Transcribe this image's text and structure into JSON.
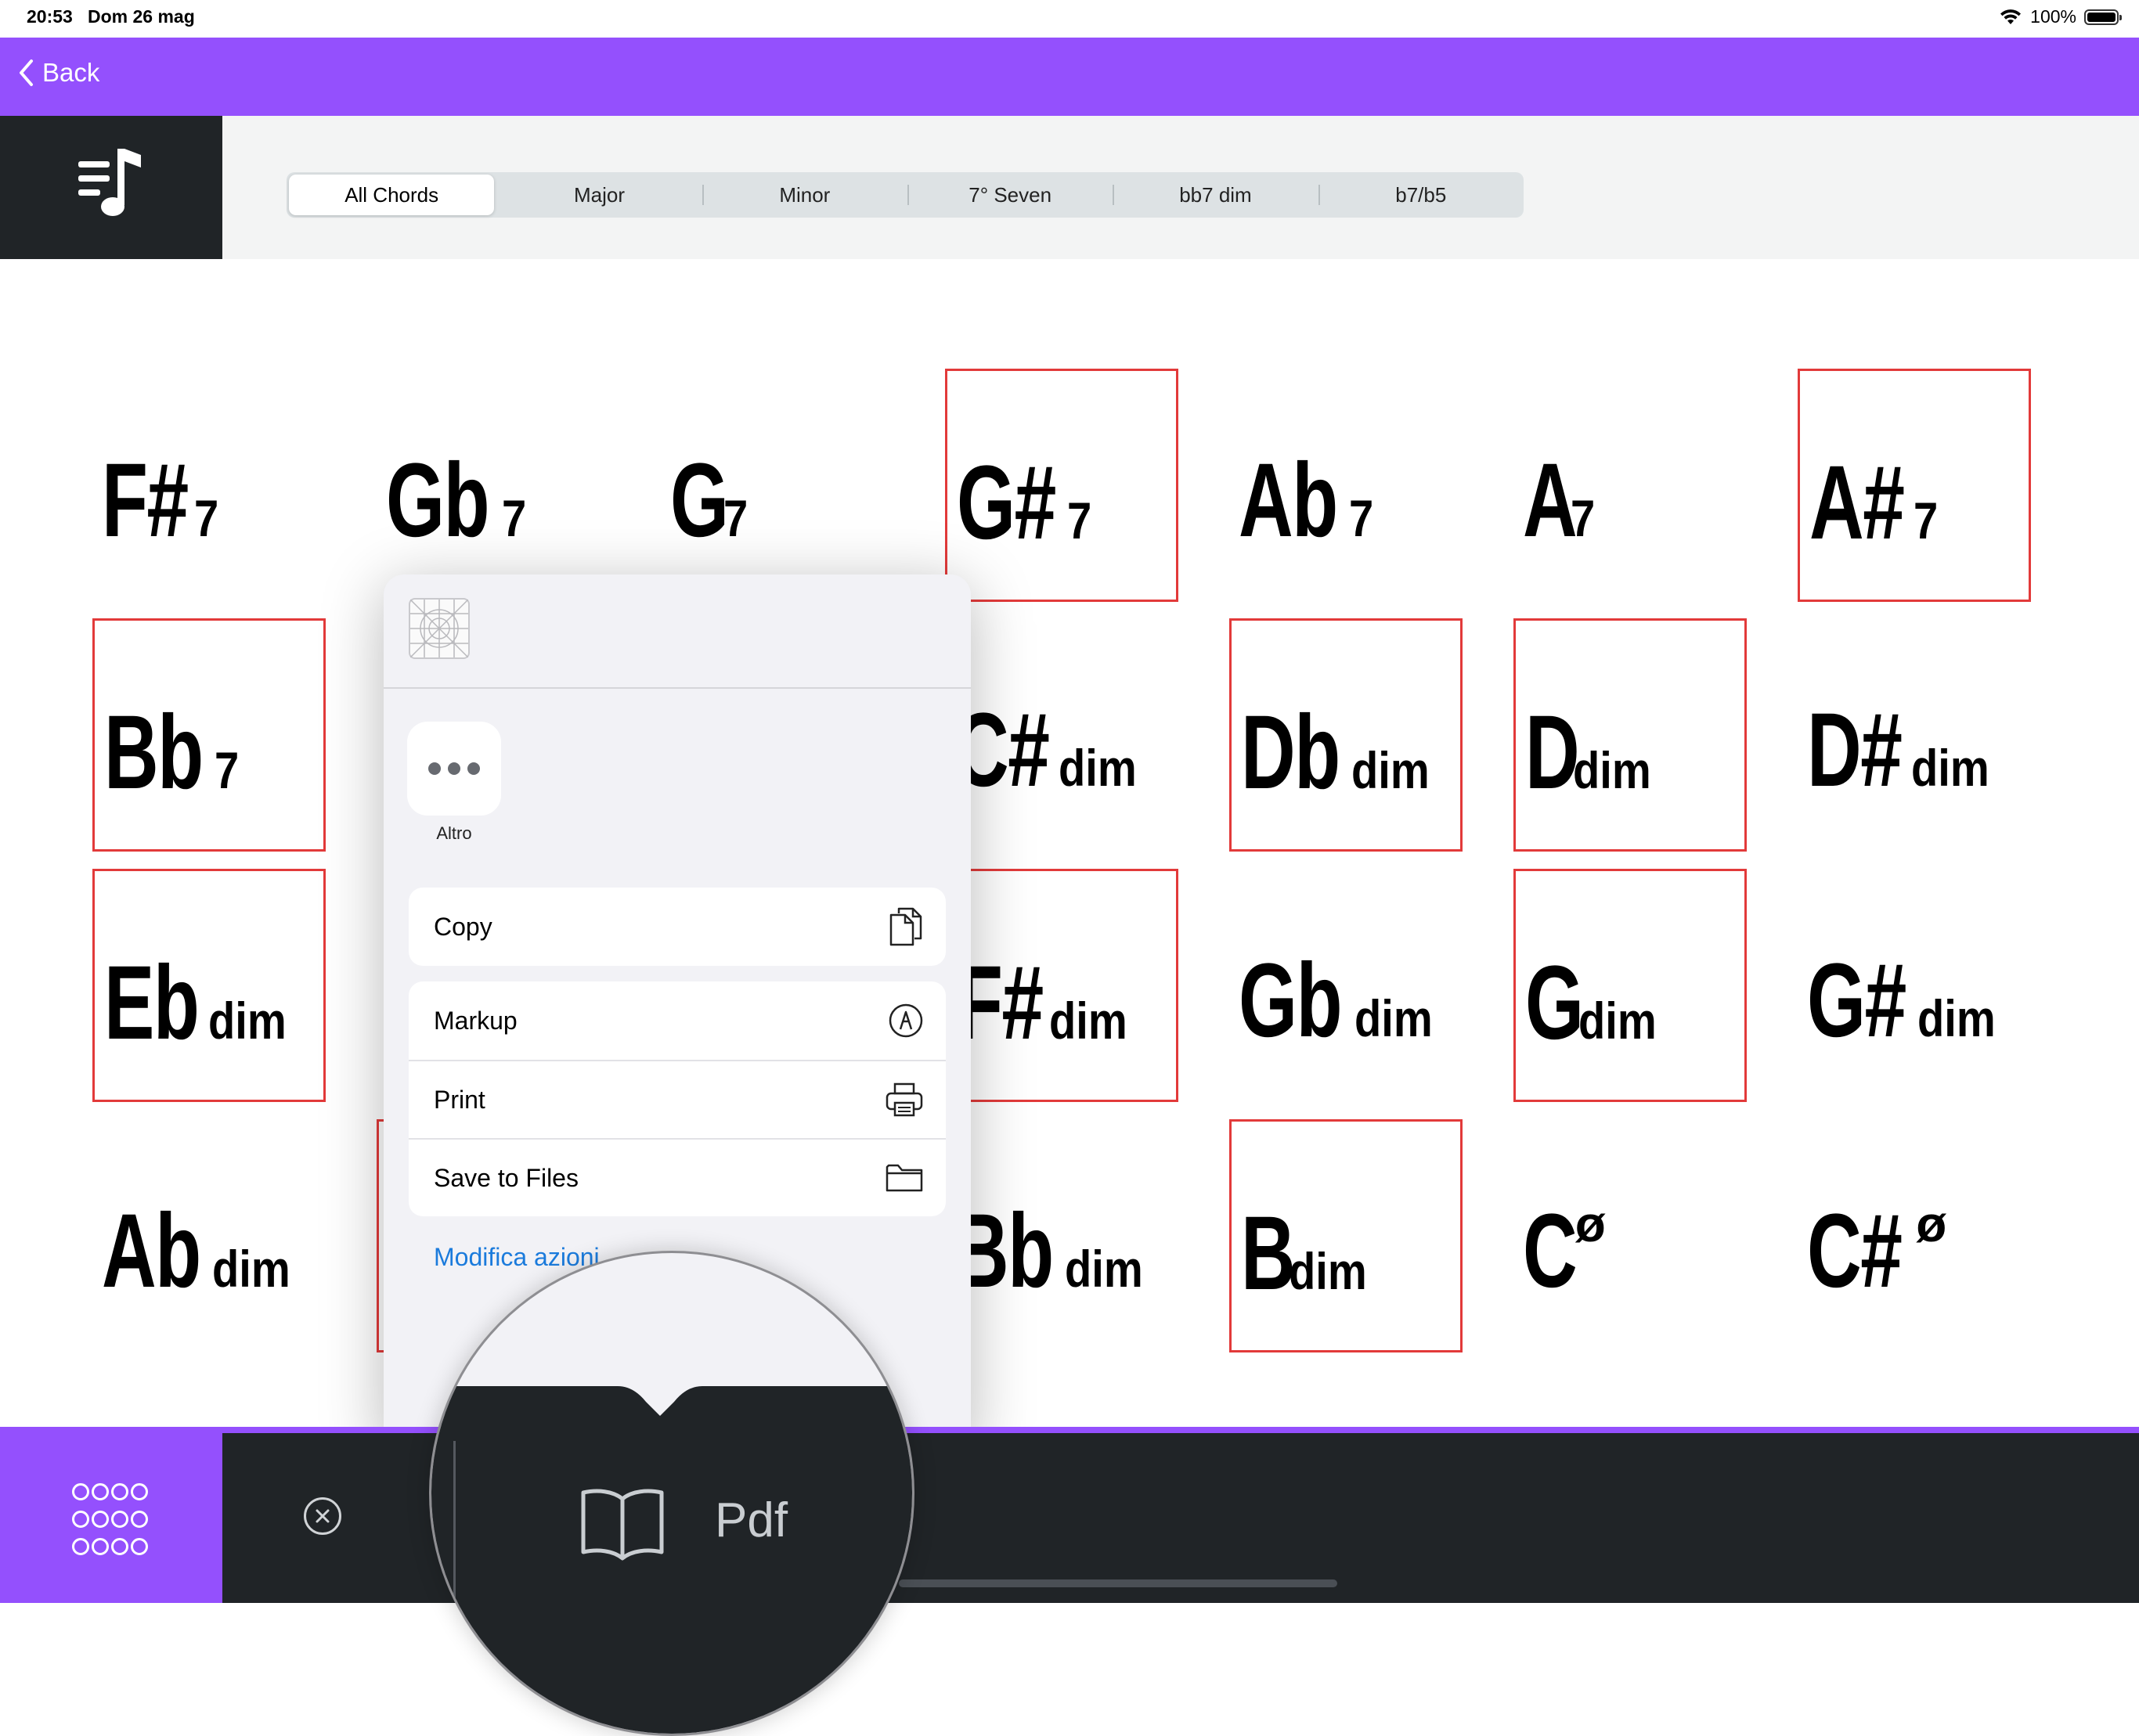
{
  "status_bar": {
    "time": "20:53",
    "date": "Dom 26 mag",
    "battery": "100%",
    "wifi_icon": "wifi-icon"
  },
  "navbar": {
    "back_label": "Back",
    "color": "#9450fd"
  },
  "tabs": [
    {
      "label": "All Chords",
      "active": true
    },
    {
      "label": "Major",
      "active": false
    },
    {
      "label": "Minor",
      "active": false
    },
    {
      "label": "7° Seven",
      "active": false
    },
    {
      "label": "bb7 dim",
      "active": false
    },
    {
      "label": "b7/b5",
      "active": false
    }
  ],
  "chords": [
    {
      "root": "F#",
      "suffix": "7",
      "highlight": false
    },
    {
      "root": "Gb",
      "suffix": "7",
      "highlight": false
    },
    {
      "root": "G",
      "suffix": "7",
      "highlight": false
    },
    {
      "root": "G#",
      "suffix": "7",
      "highlight": true
    },
    {
      "root": "Ab",
      "suffix": "7",
      "highlight": false
    },
    {
      "root": "A",
      "suffix": "7",
      "highlight": false
    },
    {
      "root": "A#",
      "suffix": "7",
      "highlight": true
    },
    {
      "root": "Bb",
      "suffix": "7",
      "highlight": true
    },
    {
      "root": "",
      "suffix": "",
      "highlight": false
    },
    {
      "root": "",
      "suffix": "",
      "highlight": false
    },
    {
      "root": "C#",
      "suffix": "dim",
      "highlight": false
    },
    {
      "root": "Db",
      "suffix": "dim",
      "highlight": true
    },
    {
      "root": "D",
      "suffix": "dim",
      "highlight": true
    },
    {
      "root": "D#",
      "suffix": "dim",
      "highlight": false
    },
    {
      "root": "Eb",
      "suffix": "dim",
      "highlight": true
    },
    {
      "root": "",
      "suffix": "",
      "highlight": false
    },
    {
      "root": "",
      "suffix": "",
      "highlight": false
    },
    {
      "root": "F#",
      "suffix": "dim",
      "highlight": true
    },
    {
      "root": "Gb",
      "suffix": "dim",
      "highlight": false
    },
    {
      "root": "G",
      "suffix": "dim",
      "highlight": true
    },
    {
      "root": "G#",
      "suffix": "dim",
      "highlight": false
    },
    {
      "root": "Ab",
      "suffix": "dim",
      "highlight": false
    },
    {
      "root": "",
      "suffix": "",
      "highlight": true
    },
    {
      "root": "",
      "suffix": "",
      "highlight": false
    },
    {
      "root": "Bb",
      "suffix": "dim",
      "highlight": false
    },
    {
      "root": "B",
      "suffix": "dim",
      "highlight": true
    },
    {
      "root": "C",
      "suffix": "",
      "superscript": "ø",
      "highlight": false
    },
    {
      "root": "C#",
      "suffix": "",
      "superscript": "ø",
      "highlight": false
    }
  ],
  "share_sheet": {
    "more_label": "Altro",
    "action_groups": [
      [
        {
          "label": "Copy",
          "icon": "copy-icon"
        }
      ],
      [
        {
          "label": "Markup",
          "icon": "markup-icon"
        },
        {
          "label": "Print",
          "icon": "print-icon"
        },
        {
          "label": "Save to Files",
          "icon": "folder-icon"
        }
      ]
    ],
    "edit_actions": "Modifica azioni"
  },
  "bottom_bar": {
    "pdf_label": "Pdf",
    "book_icon": "book-icon"
  },
  "highlight_color": "#e23a3a"
}
